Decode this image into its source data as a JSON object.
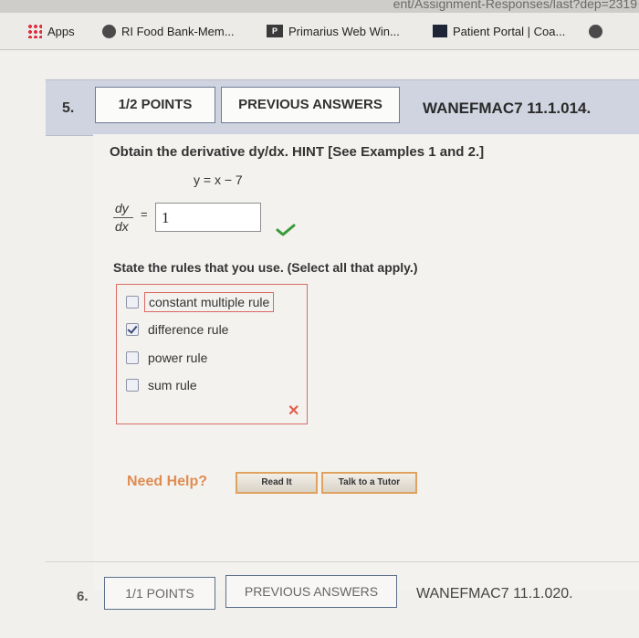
{
  "browser": {
    "url_fragment": "ent/Assignment-Responses/last?dep=2319",
    "bookmarks": [
      {
        "label": "Apps",
        "icon": "apps-grid-icon"
      },
      {
        "label": "RI Food Bank-Mem...",
        "icon": "site-globe-icon"
      },
      {
        "label": "Primarius Web Win...",
        "icon": "primarius-logo-icon"
      },
      {
        "label": "Patient Portal | Coa...",
        "icon": "patient-portal-icon"
      }
    ]
  },
  "question5": {
    "number": "5.",
    "points": "1/2 POINTS",
    "previous_answers": "PREVIOUS ANSWERS",
    "code": "WANEFMAC7 11.1.014.",
    "prompt": "Obtain the derivative dy/dx. HINT [See Examples 1 and 2.]",
    "equation": "y = x − 7",
    "derivative_numerator": "dy",
    "derivative_denominator": "dx",
    "equals": "=",
    "answer_value": "1",
    "answer_status": "correct",
    "rules_prompt": "State the rules that you use. (Select all that apply.)",
    "rules": [
      {
        "label": "constant multiple rule",
        "checked": false
      },
      {
        "label": "difference rule",
        "checked": true
      },
      {
        "label": "power rule",
        "checked": false
      },
      {
        "label": "sum rule",
        "checked": false
      }
    ],
    "rules_status": "incorrect",
    "need_help": "Need Help?",
    "read_it": "Read It",
    "talk_to_tutor": "Talk to a Tutor"
  },
  "question6": {
    "number": "6.",
    "points": "1/1 POINTS",
    "previous_answers": "PREVIOUS ANSWERS",
    "code": "WANEFMAC7 11.1.020."
  },
  "colors": {
    "correct": "#3a9a3a",
    "incorrect": "#e0604f",
    "header_bg": "#cfd4e0",
    "help_orange": "#e08c52"
  }
}
